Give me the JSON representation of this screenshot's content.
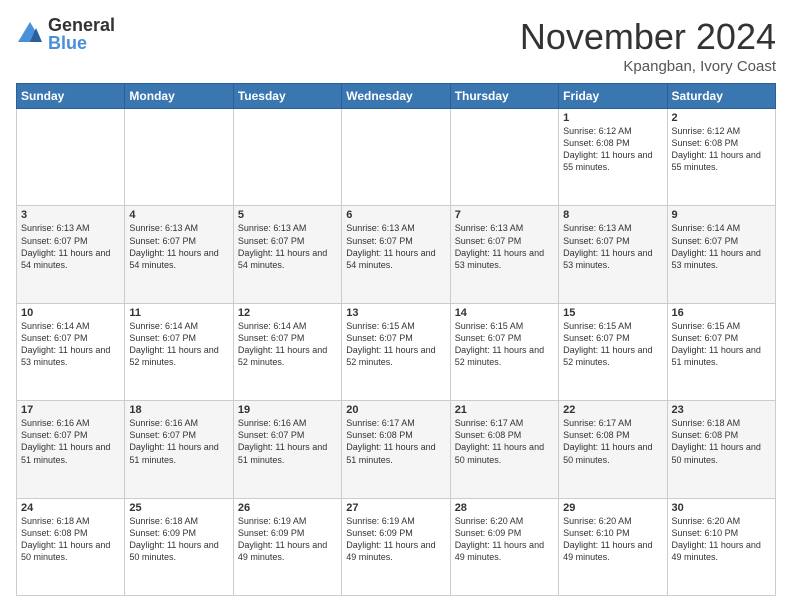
{
  "header": {
    "logo_general": "General",
    "logo_blue": "Blue",
    "month_title": "November 2024",
    "location": "Kpangban, Ivory Coast"
  },
  "weekdays": [
    "Sunday",
    "Monday",
    "Tuesday",
    "Wednesday",
    "Thursday",
    "Friday",
    "Saturday"
  ],
  "weeks": [
    [
      {
        "day": "",
        "info": ""
      },
      {
        "day": "",
        "info": ""
      },
      {
        "day": "",
        "info": ""
      },
      {
        "day": "",
        "info": ""
      },
      {
        "day": "",
        "info": ""
      },
      {
        "day": "1",
        "info": "Sunrise: 6:12 AM\nSunset: 6:08 PM\nDaylight: 11 hours\nand 55 minutes."
      },
      {
        "day": "2",
        "info": "Sunrise: 6:12 AM\nSunset: 6:08 PM\nDaylight: 11 hours\nand 55 minutes."
      }
    ],
    [
      {
        "day": "3",
        "info": "Sunrise: 6:13 AM\nSunset: 6:07 PM\nDaylight: 11 hours\nand 54 minutes."
      },
      {
        "day": "4",
        "info": "Sunrise: 6:13 AM\nSunset: 6:07 PM\nDaylight: 11 hours\nand 54 minutes."
      },
      {
        "day": "5",
        "info": "Sunrise: 6:13 AM\nSunset: 6:07 PM\nDaylight: 11 hours\nand 54 minutes."
      },
      {
        "day": "6",
        "info": "Sunrise: 6:13 AM\nSunset: 6:07 PM\nDaylight: 11 hours\nand 54 minutes."
      },
      {
        "day": "7",
        "info": "Sunrise: 6:13 AM\nSunset: 6:07 PM\nDaylight: 11 hours\nand 53 minutes."
      },
      {
        "day": "8",
        "info": "Sunrise: 6:13 AM\nSunset: 6:07 PM\nDaylight: 11 hours\nand 53 minutes."
      },
      {
        "day": "9",
        "info": "Sunrise: 6:14 AM\nSunset: 6:07 PM\nDaylight: 11 hours\nand 53 minutes."
      }
    ],
    [
      {
        "day": "10",
        "info": "Sunrise: 6:14 AM\nSunset: 6:07 PM\nDaylight: 11 hours\nand 53 minutes."
      },
      {
        "day": "11",
        "info": "Sunrise: 6:14 AM\nSunset: 6:07 PM\nDaylight: 11 hours\nand 52 minutes."
      },
      {
        "day": "12",
        "info": "Sunrise: 6:14 AM\nSunset: 6:07 PM\nDaylight: 11 hours\nand 52 minutes."
      },
      {
        "day": "13",
        "info": "Sunrise: 6:15 AM\nSunset: 6:07 PM\nDaylight: 11 hours\nand 52 minutes."
      },
      {
        "day": "14",
        "info": "Sunrise: 6:15 AM\nSunset: 6:07 PM\nDaylight: 11 hours\nand 52 minutes."
      },
      {
        "day": "15",
        "info": "Sunrise: 6:15 AM\nSunset: 6:07 PM\nDaylight: 11 hours\nand 52 minutes."
      },
      {
        "day": "16",
        "info": "Sunrise: 6:15 AM\nSunset: 6:07 PM\nDaylight: 11 hours\nand 51 minutes."
      }
    ],
    [
      {
        "day": "17",
        "info": "Sunrise: 6:16 AM\nSunset: 6:07 PM\nDaylight: 11 hours\nand 51 minutes."
      },
      {
        "day": "18",
        "info": "Sunrise: 6:16 AM\nSunset: 6:07 PM\nDaylight: 11 hours\nand 51 minutes."
      },
      {
        "day": "19",
        "info": "Sunrise: 6:16 AM\nSunset: 6:07 PM\nDaylight: 11 hours\nand 51 minutes."
      },
      {
        "day": "20",
        "info": "Sunrise: 6:17 AM\nSunset: 6:08 PM\nDaylight: 11 hours\nand 51 minutes."
      },
      {
        "day": "21",
        "info": "Sunrise: 6:17 AM\nSunset: 6:08 PM\nDaylight: 11 hours\nand 50 minutes."
      },
      {
        "day": "22",
        "info": "Sunrise: 6:17 AM\nSunset: 6:08 PM\nDaylight: 11 hours\nand 50 minutes."
      },
      {
        "day": "23",
        "info": "Sunrise: 6:18 AM\nSunset: 6:08 PM\nDaylight: 11 hours\nand 50 minutes."
      }
    ],
    [
      {
        "day": "24",
        "info": "Sunrise: 6:18 AM\nSunset: 6:08 PM\nDaylight: 11 hours\nand 50 minutes."
      },
      {
        "day": "25",
        "info": "Sunrise: 6:18 AM\nSunset: 6:09 PM\nDaylight: 11 hours\nand 50 minutes."
      },
      {
        "day": "26",
        "info": "Sunrise: 6:19 AM\nSunset: 6:09 PM\nDaylight: 11 hours\nand 49 minutes."
      },
      {
        "day": "27",
        "info": "Sunrise: 6:19 AM\nSunset: 6:09 PM\nDaylight: 11 hours\nand 49 minutes."
      },
      {
        "day": "28",
        "info": "Sunrise: 6:20 AM\nSunset: 6:09 PM\nDaylight: 11 hours\nand 49 minutes."
      },
      {
        "day": "29",
        "info": "Sunrise: 6:20 AM\nSunset: 6:10 PM\nDaylight: 11 hours\nand 49 minutes."
      },
      {
        "day": "30",
        "info": "Sunrise: 6:20 AM\nSunset: 6:10 PM\nDaylight: 11 hours\nand 49 minutes."
      }
    ]
  ]
}
